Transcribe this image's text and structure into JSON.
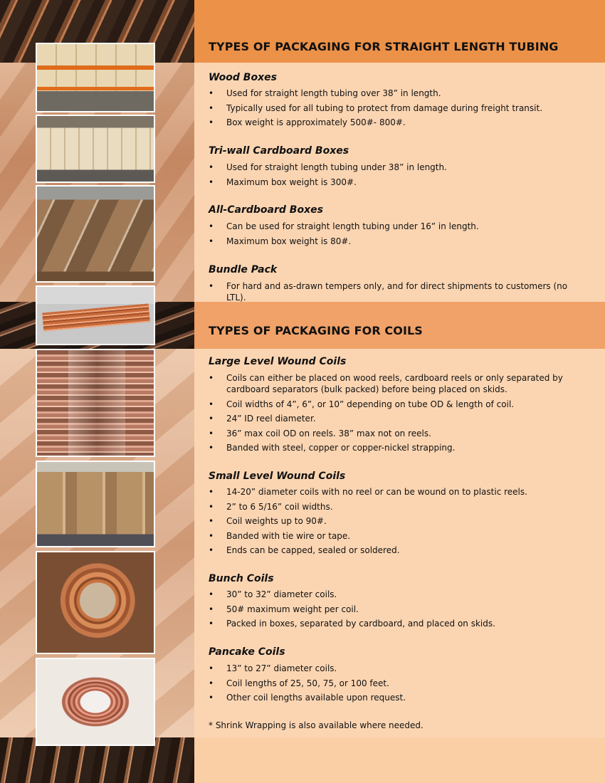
{
  "sections": [
    {
      "title": "TYPES OF PACKAGING FOR STRAIGHT LENGTH TUBING",
      "groups": [
        {
          "subtitle": "Wood Boxes",
          "items": [
            "Used for straight length tubing over 38” in length.",
            "Typically used for all tubing to protect from damage during freight transit.",
            "Box weight is approximately 500#- 800#."
          ]
        },
        {
          "subtitle": "Tri-wall Cardboard Boxes",
          "items": [
            "Used for straight length tubing under 38” in length.",
            "Maximum box weight is 300#."
          ]
        },
        {
          "subtitle": "All-Cardboard Boxes",
          "items": [
            "Can be used for straight length tubing under 16” in length.",
            "Maximum box weight is 80#."
          ]
        },
        {
          "subtitle": "Bundle Pack",
          "items": [
            "For hard and as-drawn tempers only, and for direct shipments to customers (no LTL)."
          ]
        }
      ]
    },
    {
      "title": "TYPES OF PACKAGING FOR COILS",
      "groups": [
        {
          "subtitle": "Large Level Wound Coils",
          "items": [
            "Coils can either be placed on wood reels, cardboard reels or only separated by cardboard separators (bulk packed) before being placed on skids.",
            "Coil widths of 4”, 6”, or 10” depending on tube OD & length of coil.",
            "24” ID reel diameter.",
            "36” max coil OD on reels. 38” max not on reels.",
            "Banded with steel, copper or copper-nickel strapping."
          ]
        },
        {
          "subtitle": "Small Level Wound Coils",
          "items": [
            "14-20” diameter coils with no reel or can be wound on to plastic reels.",
            "2” to 6 5/16” coil widths.",
            "Coil weights up to 90#.",
            "Banded with tie wire or tape.",
            "Ends can be capped, sealed or soldered."
          ]
        },
        {
          "subtitle": "Bunch Coils",
          "items": [
            "30” to 32” diameter coils.",
            "50# maximum weight per coil.",
            "Packed in boxes, separated by cardboard, and placed on skids."
          ]
        },
        {
          "subtitle": "Pancake Coils",
          "items": [
            "13” to 27” diameter coils.",
            "Coil lengths of 25, 50, 75, or 100 feet.",
            "Other coil lengths available upon request."
          ]
        }
      ]
    }
  ],
  "footnote": "* Shrink Wrapping is also available where needed.",
  "colors": {
    "header_band": "#ec9148",
    "header_band_2": "#f0a269",
    "body_bg": "#fbd5b2"
  }
}
